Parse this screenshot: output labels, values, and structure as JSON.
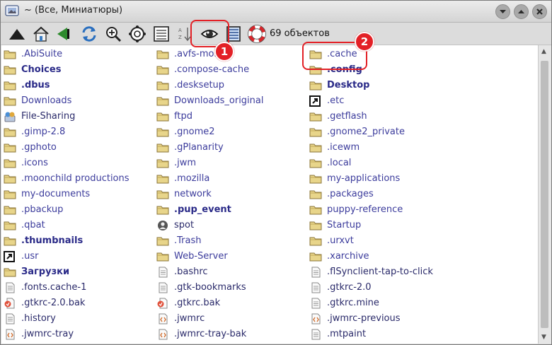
{
  "window": {
    "title": "~ (Все, Миниатюры)"
  },
  "toolbar": {
    "buttons": [
      {
        "name": "up-arrow-icon"
      },
      {
        "name": "home-icon"
      },
      {
        "name": "back-icon"
      },
      {
        "name": "refresh-icon"
      },
      {
        "name": "zoom-in-icon"
      },
      {
        "name": "zoom-fit-icon"
      },
      {
        "name": "details-view-icon"
      },
      {
        "name": "sort-icon"
      },
      {
        "name": "eye-icon"
      },
      {
        "name": "list-view-icon"
      },
      {
        "name": "help-lifebuoy-icon"
      }
    ],
    "object_count": "69 объектов"
  },
  "callouts": [
    {
      "number": "1"
    },
    {
      "number": "2"
    }
  ],
  "colors": {
    "callout": "#e32026",
    "folder": "#e8d58a",
    "link_text": "#3c3c9c"
  },
  "files": [
    [
      {
        "name": ".AbiSuite",
        "icon": "folder",
        "bold": false
      },
      {
        "name": "Choices",
        "icon": "folder",
        "bold": true
      },
      {
        "name": ".dbus",
        "icon": "folder",
        "bold": true
      },
      {
        "name": "Downloads",
        "icon": "folder",
        "bold": false
      },
      {
        "name": "File-Sharing",
        "icon": "share",
        "bold": false
      },
      {
        "name": ".gimp-2.8",
        "icon": "folder",
        "bold": false
      },
      {
        "name": ".gphoto",
        "icon": "folder",
        "bold": false
      },
      {
        "name": ".icons",
        "icon": "folder",
        "bold": false
      },
      {
        "name": ".moonchild productions",
        "icon": "folder",
        "bold": false
      },
      {
        "name": "my-documents",
        "icon": "folder",
        "bold": false
      },
      {
        "name": ".pbackup",
        "icon": "folder",
        "bold": false
      },
      {
        "name": ".qbat",
        "icon": "folder",
        "bold": false
      },
      {
        "name": ".thumbnails",
        "icon": "folder",
        "bold": true
      },
      {
        "name": ".usr",
        "icon": "symlink",
        "bold": false
      },
      {
        "name": "Загрузки",
        "icon": "folder",
        "bold": true
      },
      {
        "name": ".fonts.cache-1",
        "icon": "text",
        "bold": false
      },
      {
        "name": ".gtkrc-2.0.bak",
        "icon": "backup",
        "bold": false
      },
      {
        "name": ".history",
        "icon": "text",
        "bold": false
      },
      {
        "name": ".jwmrc-tray",
        "icon": "code",
        "bold": false
      }
    ],
    [
      {
        "name": ".avfs-mo...",
        "icon": "folder",
        "bold": false
      },
      {
        "name": ".compose-cache",
        "icon": "folder",
        "bold": false
      },
      {
        "name": ".desksetup",
        "icon": "folder",
        "bold": false
      },
      {
        "name": "Downloads_original",
        "icon": "folder",
        "bold": false
      },
      {
        "name": "ftpd",
        "icon": "folder",
        "bold": false
      },
      {
        "name": ".gnome2",
        "icon": "folder",
        "bold": false
      },
      {
        "name": ".gPlanarity",
        "icon": "folder",
        "bold": false
      },
      {
        "name": ".jwm",
        "icon": "folder",
        "bold": false
      },
      {
        "name": ".mozilla",
        "icon": "folder",
        "bold": false
      },
      {
        "name": "network",
        "icon": "folder",
        "bold": false
      },
      {
        "name": ".pup_event",
        "icon": "folder",
        "bold": true
      },
      {
        "name": "spot",
        "icon": "user",
        "bold": false
      },
      {
        "name": ".Trash",
        "icon": "folder",
        "bold": false
      },
      {
        "name": "Web-Server",
        "icon": "folder",
        "bold": false
      },
      {
        "name": ".bashrc",
        "icon": "text",
        "bold": false
      },
      {
        "name": ".gtk-bookmarks",
        "icon": "text",
        "bold": false
      },
      {
        "name": ".gtkrc.bak",
        "icon": "backup",
        "bold": false
      },
      {
        "name": ".jwmrc",
        "icon": "code",
        "bold": false
      },
      {
        "name": ".jwmrc-tray-bak",
        "icon": "code",
        "bold": false
      }
    ],
    [
      {
        "name": ".cache",
        "icon": "folder",
        "bold": false
      },
      {
        "name": ".config",
        "icon": "folder",
        "bold": true
      },
      {
        "name": "Desktop",
        "icon": "folder",
        "bold": true
      },
      {
        "name": ".etc",
        "icon": "symlink",
        "bold": false
      },
      {
        "name": ".getflash",
        "icon": "folder",
        "bold": false
      },
      {
        "name": ".gnome2_private",
        "icon": "folder",
        "bold": false
      },
      {
        "name": ".icewm",
        "icon": "folder",
        "bold": false
      },
      {
        "name": ".local",
        "icon": "folder",
        "bold": false
      },
      {
        "name": "my-applications",
        "icon": "folder",
        "bold": false
      },
      {
        "name": ".packages",
        "icon": "folder",
        "bold": false
      },
      {
        "name": "puppy-reference",
        "icon": "folder",
        "bold": false
      },
      {
        "name": "Startup",
        "icon": "folder",
        "bold": false
      },
      {
        "name": ".urxvt",
        "icon": "folder",
        "bold": false
      },
      {
        "name": ".xarchive",
        "icon": "folder",
        "bold": false
      },
      {
        "name": ".flSynclient-tap-to-click",
        "icon": "text",
        "bold": false
      },
      {
        "name": ".gtkrc-2.0",
        "icon": "text",
        "bold": false
      },
      {
        "name": ".gtkrc.mine",
        "icon": "text",
        "bold": false
      },
      {
        "name": ".jwmrc-previous",
        "icon": "code",
        "bold": false
      },
      {
        "name": ".mtpaint",
        "icon": "text",
        "bold": false
      }
    ]
  ]
}
